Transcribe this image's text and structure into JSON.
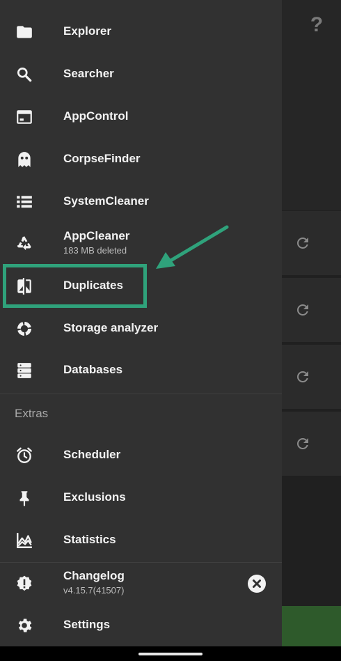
{
  "background": {
    "help_glyph": "?",
    "refresh_buttons": [
      "refresh-icon",
      "refresh-icon",
      "refresh-icon",
      "refresh-icon"
    ],
    "fab_color": "#2e5a2b"
  },
  "drawer": {
    "items": [
      {
        "label": "Explorer",
        "icon": "folder-icon"
      },
      {
        "label": "Searcher",
        "icon": "search-icon"
      },
      {
        "label": "AppControl",
        "icon": "app-window-icon"
      },
      {
        "label": "CorpseFinder",
        "icon": "ghost-icon"
      },
      {
        "label": "SystemCleaner",
        "icon": "list-icon"
      },
      {
        "label": "AppCleaner",
        "sub": "183 MB deleted",
        "icon": "recycle-icon"
      },
      {
        "label": "Duplicates",
        "icon": "compare-icon"
      },
      {
        "label": "Storage analyzer",
        "icon": "donut-chart-icon"
      },
      {
        "label": "Databases",
        "icon": "server-icon"
      }
    ],
    "extras_header": "Extras",
    "extras": [
      {
        "label": "Scheduler",
        "icon": "alarm-icon"
      },
      {
        "label": "Exclusions",
        "icon": "pin-icon"
      },
      {
        "label": "Statistics",
        "icon": "stats-icon"
      }
    ],
    "bottom": [
      {
        "label": "Changelog",
        "sub": "v4.15.7(41507)",
        "icon": "alert-badge-icon"
      },
      {
        "label": "Settings",
        "icon": "gear-icon"
      }
    ]
  },
  "annotation": {
    "color": "#2fa27b",
    "target": "Duplicates"
  }
}
